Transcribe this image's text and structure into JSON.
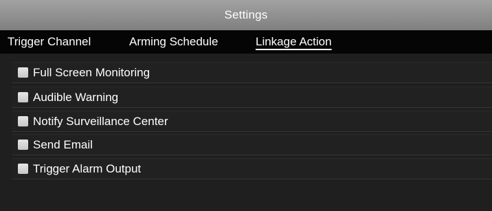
{
  "window": {
    "title": "Settings"
  },
  "tabs": [
    {
      "label": "Trigger Channel",
      "active": false
    },
    {
      "label": "Arming Schedule",
      "active": false
    },
    {
      "label": "Linkage Action",
      "active": true
    }
  ],
  "linkage_actions": [
    {
      "label": "Full Screen Monitoring",
      "checked": false
    },
    {
      "label": "Audible Warning",
      "checked": false
    },
    {
      "label": "Notify Surveillance Center",
      "checked": false
    },
    {
      "label": "Send Email",
      "checked": false
    },
    {
      "label": "Trigger Alarm Output",
      "checked": false
    }
  ],
  "colors": {
    "titlebar": "#8f8f8f",
    "tabbar": "#050505",
    "background": "#1f1f1f",
    "checkbox": "#d6d6d6",
    "text": "#ffffff"
  }
}
